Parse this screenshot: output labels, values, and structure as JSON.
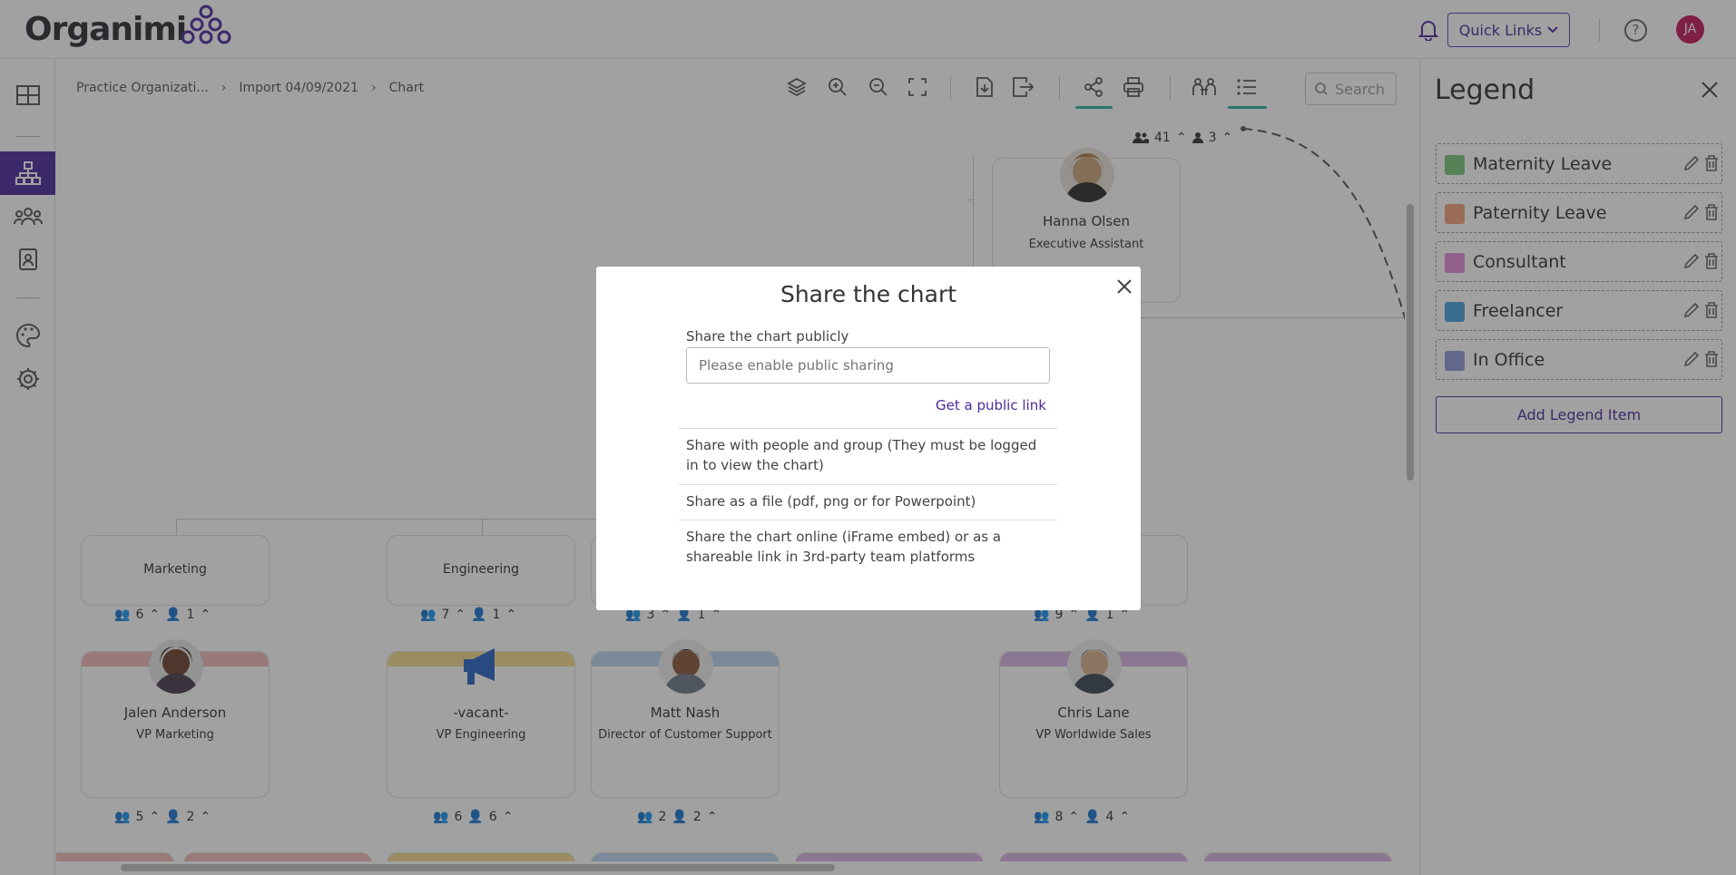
{
  "app": {
    "logo_text": "Organimi",
    "user_initials": "JA"
  },
  "header": {
    "quick_links_label": "Quick Links",
    "help_glyph": "?"
  },
  "breadcrumb": [
    "Practice Organizati...",
    "Import 04/09/2021",
    "Chart"
  ],
  "toolbar": {
    "search_placeholder": "Search"
  },
  "chart": {
    "top_node": {
      "name": "Hanna Olsen",
      "title": "Executive Assistant",
      "count_team": "41",
      "count_direct": "3"
    },
    "departments": [
      {
        "label": "Marketing",
        "count_team": "6",
        "count_direct": "1"
      },
      {
        "label": "Engineering",
        "count_team": "7",
        "count_direct": "1"
      },
      {
        "label": "",
        "count_team": "3",
        "count_direct": "1"
      },
      {
        "label": "",
        "count_team": "9",
        "count_direct": "1"
      }
    ],
    "people": [
      {
        "name": "Jalen Anderson",
        "title": "VP Marketing",
        "count_team": "5",
        "count_direct": "2",
        "band_color": "#f2b8b8"
      },
      {
        "name": "-vacant-",
        "title": "VP Engineering",
        "count_team": "6",
        "count_direct": "6",
        "band_color": "#f5dc8e",
        "vacant_badge": "WE'RE HIRING"
      },
      {
        "name": "Matt Nash",
        "title": "Director of Customer Support",
        "count_team": "2",
        "count_direct": "2",
        "band_color": "#b9d7f0"
      },
      {
        "name": "Chris Lane",
        "title": "VP Worldwide Sales",
        "count_team": "8",
        "count_direct": "4",
        "band_color": "#d9b5e6"
      }
    ]
  },
  "modal": {
    "title": "Share the chart",
    "public_label": "Share the chart publicly",
    "public_placeholder": "Please enable public sharing",
    "public_link": "Get a public link",
    "option_people": "Share with people and group (They must be logged in to view the chart)",
    "option_file": "Share as a file (pdf, png or for Powerpoint)",
    "option_online": "Share the chart online (iFrame embed) or as a shareable link in 3rd-party team platforms"
  },
  "legend": {
    "title": "Legend",
    "items": [
      {
        "label": "Maternity Leave",
        "color": "#7bc67b"
      },
      {
        "label": "Paternity Leave",
        "color": "#f2a07b"
      },
      {
        "label": "Consultant",
        "color": "#e08ad6"
      },
      {
        "label": "Freelancer",
        "color": "#4aa3df"
      },
      {
        "label": "In Office",
        "color": "#8f9ad9"
      }
    ],
    "add_label": "Add Legend Item"
  },
  "colors": {
    "accent": "#4b2a9e",
    "teal": "#2bb3a3"
  }
}
